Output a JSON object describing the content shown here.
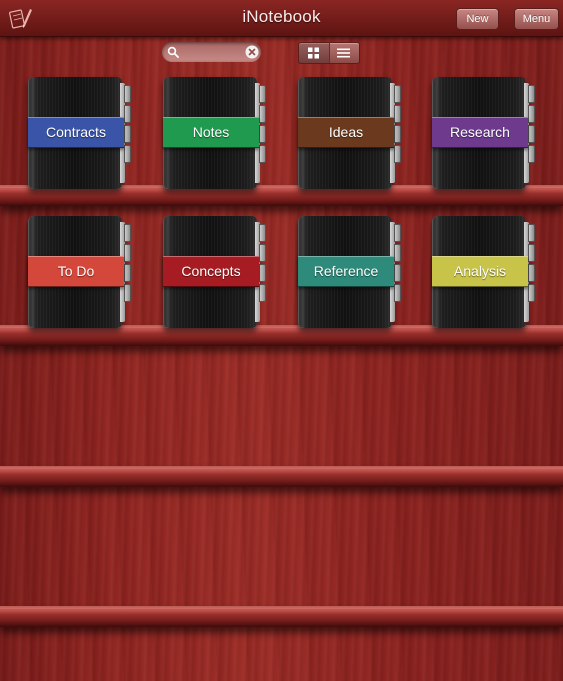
{
  "header": {
    "title": "iNotebook",
    "logo_icon": "pen-and-notepad-icon",
    "new_label": "New",
    "menu_label": "Menu"
  },
  "search": {
    "value": "",
    "placeholder": ""
  },
  "view_toggle": {
    "options": [
      "grid-view",
      "list-view"
    ],
    "selected": "grid-view"
  },
  "notebooks": [
    {
      "label": "Contracts",
      "color": "#3a55a8"
    },
    {
      "label": "Notes",
      "color": "#1f9a4e"
    },
    {
      "label": "Ideas",
      "color": "#6b3a1e"
    },
    {
      "label": "Research",
      "color": "#6d3a8e"
    },
    {
      "label": "To Do",
      "color": "#d4473b"
    },
    {
      "label": "Concepts",
      "color": "#a61c22"
    },
    {
      "label": "Reference",
      "color": "#2e8a7a"
    },
    {
      "label": "Analysis",
      "color": "#c8c44a"
    }
  ],
  "colors": {
    "background": "#8e2420",
    "topbar": "#6e1a18",
    "button": "#b06a66"
  }
}
